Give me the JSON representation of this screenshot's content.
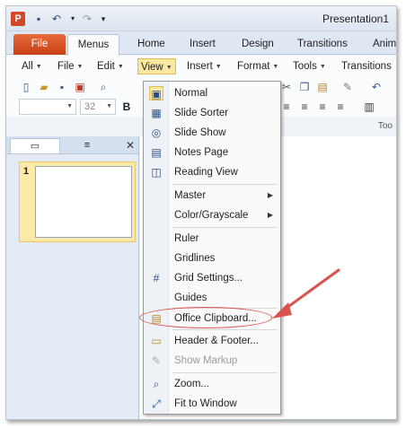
{
  "window": {
    "title": "Presentation1",
    "app_logo": "P"
  },
  "quick_access": [
    {
      "name": "save-icon",
      "glyph": "💾"
    },
    {
      "name": "undo-icon",
      "glyph": "↶"
    },
    {
      "name": "redo-icon",
      "glyph": "↷"
    }
  ],
  "ribbon_tabs": [
    "File",
    "Menus",
    "Home",
    "Insert",
    "Design",
    "Transitions",
    "Anim"
  ],
  "menubar": [
    "All",
    "File",
    "Edit",
    "View",
    "Insert",
    "Format",
    "Tools",
    "Transitions"
  ],
  "toolbar": {
    "font_size": "32",
    "bold": "B",
    "group_label": "Too"
  },
  "panel": {
    "slide_number": "1"
  },
  "view_menu": {
    "items": [
      {
        "label": "Normal",
        "icon": "normal-view-icon",
        "glyph": "▣",
        "selected": true
      },
      {
        "label": "Slide Sorter",
        "icon": "slide-sorter-icon",
        "glyph": "▦"
      },
      {
        "label": "Slide Show",
        "icon": "slide-show-icon",
        "glyph": "◎"
      },
      {
        "label": "Notes Page",
        "icon": "notes-page-icon",
        "glyph": "▤"
      },
      {
        "label": "Reading View",
        "icon": "reading-view-icon",
        "glyph": "📖"
      },
      {
        "label": "Master",
        "submenu": true
      },
      {
        "label": "Color/Grayscale",
        "submenu": true
      },
      {
        "label": "Ruler"
      },
      {
        "label": "Gridlines"
      },
      {
        "label": "Grid Settings...",
        "icon": "grid-icon",
        "glyph": "#"
      },
      {
        "label": "Guides"
      },
      {
        "label": "Office Clipboard...",
        "icon": "clipboard-icon",
        "glyph": "📋"
      },
      {
        "label": "Header & Footer...",
        "icon": "header-footer-icon",
        "glyph": "▭"
      },
      {
        "label": "Show Markup",
        "icon": "markup-icon",
        "glyph": "✎",
        "disabled": true
      },
      {
        "label": "Zoom...",
        "icon": "zoom-icon",
        "glyph": "🔍"
      },
      {
        "label": "Fit to Window",
        "icon": "fit-window-icon",
        "glyph": "⤢"
      }
    ]
  },
  "colors": {
    "file_tab": "#d24726",
    "highlight": "#fde9a8",
    "annotation": "#d9534f"
  }
}
